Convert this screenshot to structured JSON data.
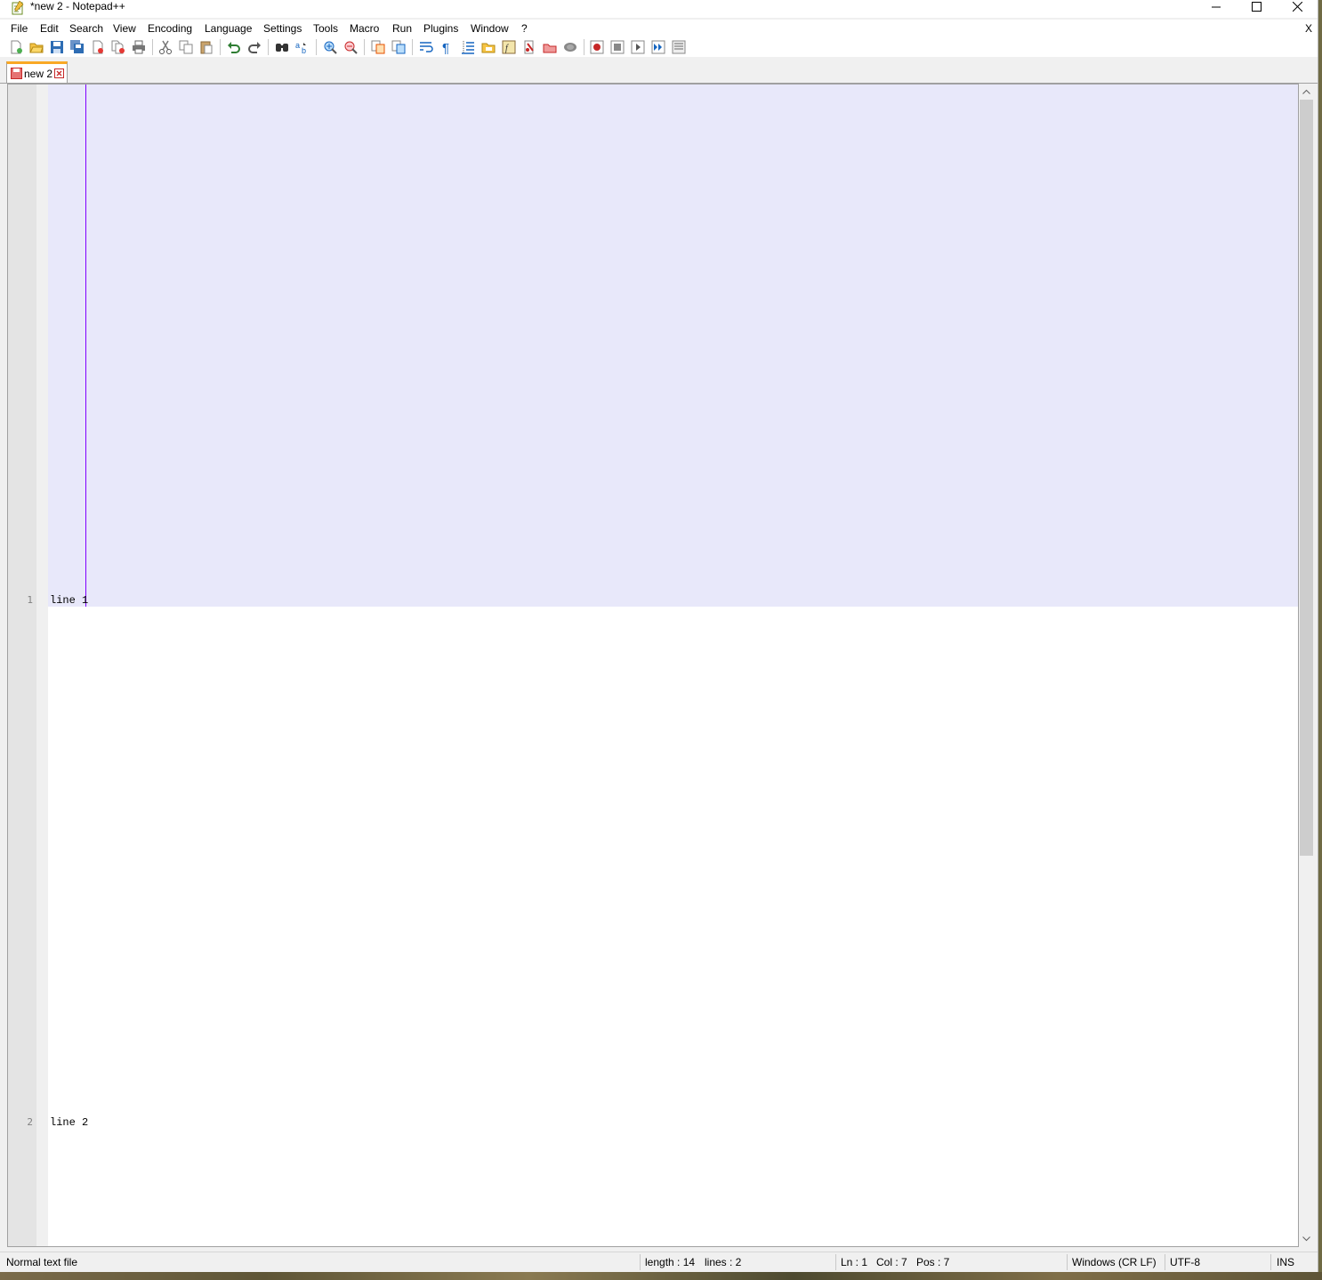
{
  "window": {
    "title": "*new 2 - Notepad++"
  },
  "menu": {
    "items": [
      "File",
      "Edit",
      "Search",
      "View",
      "Encoding",
      "Language",
      "Settings",
      "Tools",
      "Macro",
      "Run",
      "Plugins",
      "Window",
      "?"
    ],
    "doc_close": "X"
  },
  "toolbar": {
    "icons": [
      "new-file-icon",
      "open-file-icon",
      "save-icon",
      "save-all-icon",
      "close-icon",
      "close-all-icon",
      "print-icon",
      "cut-icon",
      "copy-icon",
      "paste-icon",
      "undo-icon",
      "redo-icon",
      "find-icon",
      "replace-icon",
      "zoom-in-icon",
      "zoom-out-icon",
      "sync-vertical-icon",
      "sync-horizontal-icon",
      "word-wrap-icon",
      "show-all-chars-icon",
      "indent-guide-icon",
      "folder-as-workspace-icon",
      "function-list-icon",
      "doc-map-icon",
      "document-list-icon",
      "monitoring-icon",
      "macro-record-icon",
      "macro-stop-icon",
      "macro-play-icon",
      "macro-run-multiple-icon",
      "macro-save-icon"
    ]
  },
  "tab": {
    "label": "new 2"
  },
  "editor": {
    "lines": [
      {
        "number": "1",
        "text": "line 1"
      },
      {
        "number": "2",
        "text": "line 2"
      }
    ],
    "current_line_color": "#e8e8fa",
    "caret_color": "#8000ff"
  },
  "status": {
    "file_type": "Normal text file",
    "length": "length : 14",
    "lines": "lines : 2",
    "ln": "Ln : 1",
    "col": "Col : 7",
    "pos": "Pos : 7",
    "eol": "Windows (CR LF)",
    "encoding": "UTF-8",
    "mode": "INS"
  }
}
